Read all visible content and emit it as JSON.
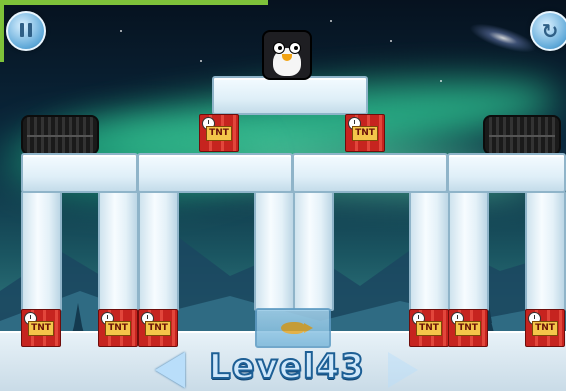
{
  "game": {
    "level_word": "Level",
    "level_number": "43",
    "tnt_label": "TNT"
  },
  "controls": {
    "pause_icon": "pause-icon",
    "restart_icon": "restart-icon",
    "prev_icon": "arrow-left-icon",
    "next_icon": "arrow-right-icon"
  },
  "colors": {
    "accent_green": "#7ec23a",
    "ice": "#e4f1f8",
    "tnt_red": "#c6241f",
    "level_text": "#cfe8fb"
  }
}
